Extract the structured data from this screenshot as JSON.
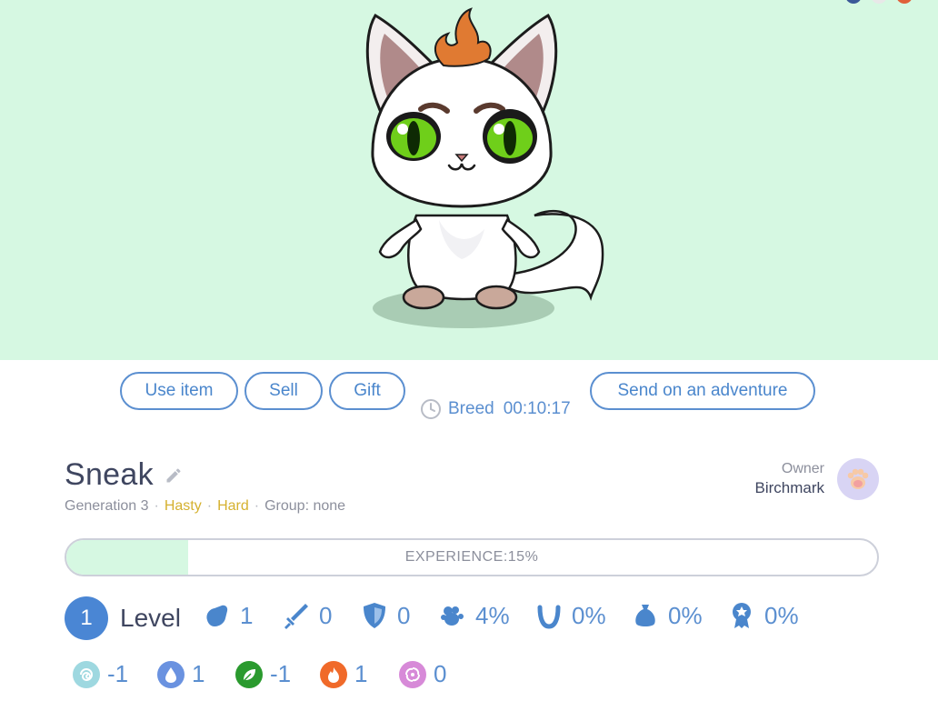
{
  "actions": {
    "use_item": "Use item",
    "sell": "Sell",
    "gift": "Gift",
    "breed_label": "Breed",
    "breed_timer": "00:10:17",
    "adventure": "Send on an adventure"
  },
  "pet": {
    "name": "Sneak",
    "generation": "Generation 3",
    "trait1": "Hasty",
    "trait2": "Hard",
    "group": "Group: none"
  },
  "owner": {
    "label": "Owner",
    "name": "Birchmark"
  },
  "experience": {
    "label": "EXPERIENCE:15%",
    "fraction": 0.15
  },
  "stats": {
    "level_value": "1",
    "level_label": "Level",
    "strength": "1",
    "attack": "0",
    "defense": "0",
    "stealth": "4%",
    "luck": "0%",
    "loot": "0%",
    "reward": "0%"
  },
  "elements": {
    "air": "-1",
    "water": "1",
    "nature": "-1",
    "fire": "1",
    "magic": "0"
  },
  "colors": {
    "background": "#d6f8e2",
    "accent": "#4a86cc",
    "trait_yellow": "#d5b12f",
    "text_dark": "#3f4660"
  }
}
